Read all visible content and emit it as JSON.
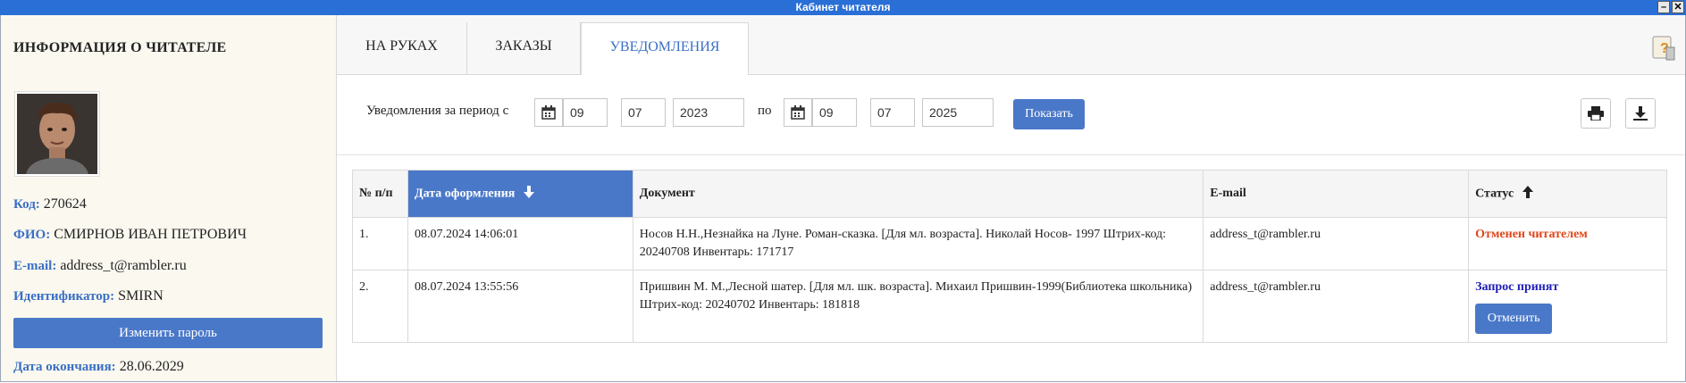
{
  "window": {
    "title": "Кабинет читателя",
    "minimize": "–",
    "close": "✕"
  },
  "reader": {
    "title": "ИНФОРМАЦИЯ О ЧИТАТЕЛЕ",
    "fields": [
      {
        "label": "Код:",
        "value": "270624"
      },
      {
        "label": "ФИО:",
        "value": "СМИРНОВ ИВАН ПЕТРОВИЧ"
      },
      {
        "label": "E-mail:",
        "value": "address_t@rambler.ru"
      },
      {
        "label": "Идентификатор:",
        "value": "SMIRN"
      }
    ],
    "change_password_label": "Изменить пароль",
    "end_date": {
      "label": "Дата окончания:",
      "value": "28.06.2029"
    }
  },
  "tabs": [
    {
      "label": "НА РУКАХ"
    },
    {
      "label": "ЗАКАЗЫ"
    },
    {
      "label": "УВЕДОМЛЕНИЯ"
    }
  ],
  "filter": {
    "label": "Уведомления  за период  с",
    "to_label": "по",
    "from": {
      "day": "09",
      "month": "07",
      "year": "2023"
    },
    "to": {
      "day": "09",
      "month": "07",
      "year": "2025"
    },
    "show_label": "Показать"
  },
  "table": {
    "headers": {
      "num": "№ п/п",
      "date": "Дата оформления",
      "doc": "Документ",
      "email": "E-mail",
      "status": "Статус"
    },
    "rows": [
      {
        "num": "1.",
        "date": "08.07.2024 14:06:01",
        "doc": "Носов Н.Н.,Незнайка на Луне. Роман-сказка. [Для мл. возраста]. Николай Носов- 1997 Штрих-код: 20240708 Инвентарь: 171717",
        "email": "address_t@rambler.ru",
        "status": "Отменен читателем"
      },
      {
        "num": "2.",
        "date": "08.07.2024 13:55:56",
        "doc": "Пришвин М. М.,Лесной шатер. [Для мл. шк. возраста]. Михаил Пришвин-1999(Библиотека школьника) Штрих-код: 20240702 Инвентарь: 181818",
        "email": "address_t@rambler.ru",
        "status": "Запрос принят",
        "action": "Отменить"
      }
    ]
  }
}
